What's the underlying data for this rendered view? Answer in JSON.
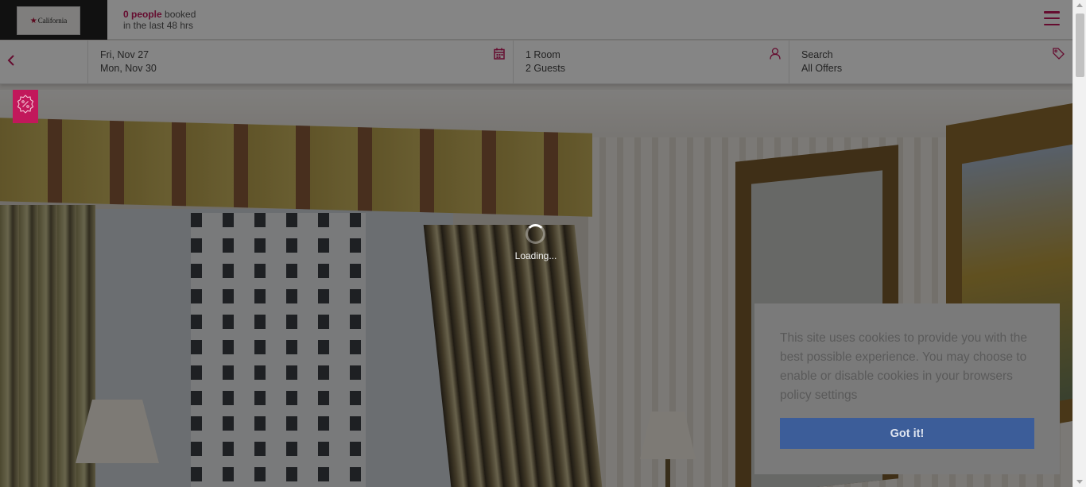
{
  "header": {
    "logo_text": "California",
    "booked_count": "0 people",
    "booked_suffix": "booked",
    "booked_line2": "in the last 48 hrs",
    "menu_icon": "hamburger-icon"
  },
  "search": {
    "back_icon": "chevron-left-icon",
    "checkin": "Fri, Nov 27",
    "checkout": "Mon, Nov 30",
    "dates_icon": "calendar-icon",
    "rooms": "1 Room",
    "guests": "2 Guests",
    "guests_icon": "user-icon",
    "offers_label": "Search",
    "offers_value": "All Offers",
    "offers_icon": "tag-icon"
  },
  "hero": {
    "offer_badge_icon": "discount-badge-icon",
    "loading_text": "Loading..."
  },
  "cookie_banner": {
    "message": "This site uses cookies to provide you with the best possible experience. You may choose to enable or disable cookies in your browsers policy settings",
    "button_label": "Got it!"
  },
  "colors": {
    "accent": "#c2185b",
    "cookie_button": "#3c5d99",
    "overlay": "rgba(0,0,0,0.48)"
  }
}
